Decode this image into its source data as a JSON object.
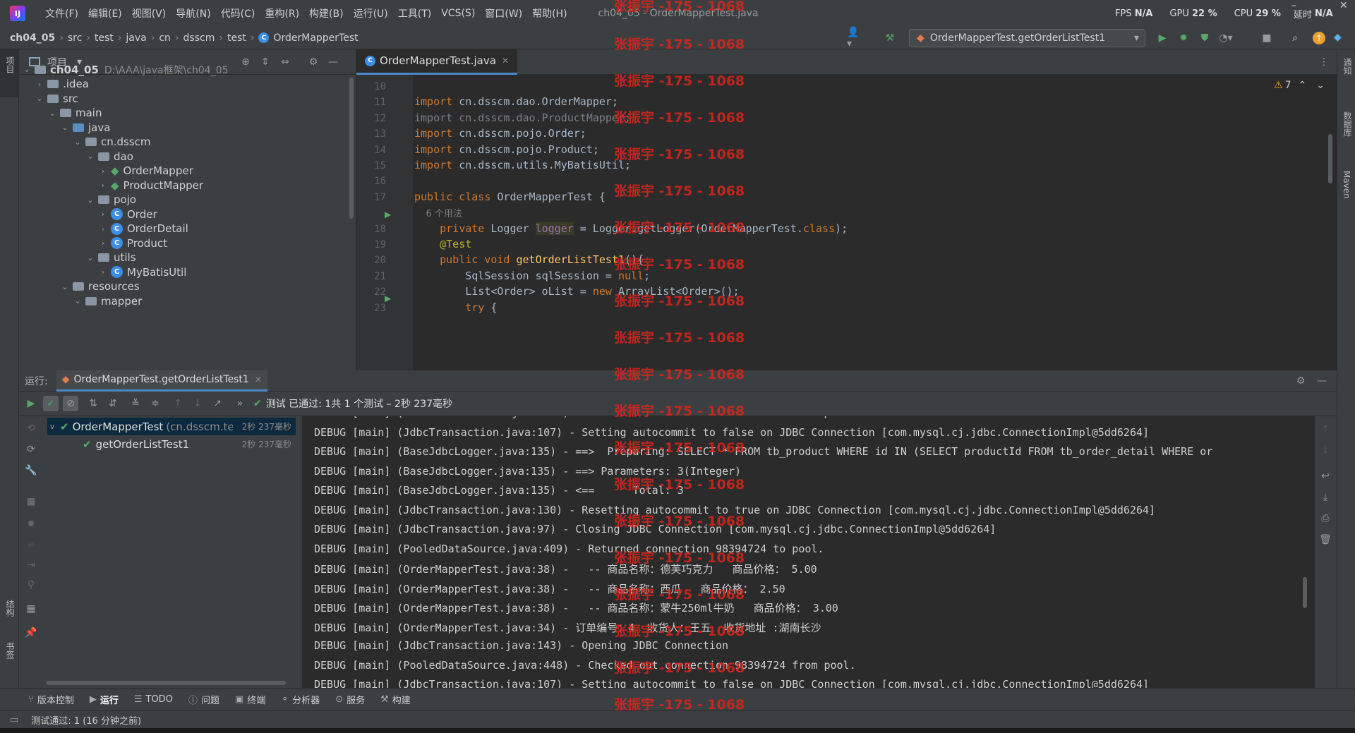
{
  "app": {
    "window_title": "ch04_05 - OrderMapperTest.java",
    "menus": [
      "文件(F)",
      "编辑(E)",
      "视图(V)",
      "导航(N)",
      "代码(C)",
      "重构(R)",
      "构建(B)",
      "运行(U)",
      "工具(T)",
      "VCS(S)",
      "窗口(W)",
      "帮助(H)"
    ],
    "stats": {
      "fps_label": "FPS",
      "fps": "N/A",
      "gpu_label": "GPU",
      "gpu": "22 %",
      "cpu_label": "CPU",
      "cpu": "29 %",
      "latency_label": "延时",
      "latency": "N/A"
    }
  },
  "breadcrumb": [
    "ch04_05",
    "src",
    "test",
    "java",
    "cn",
    "dsscm",
    "test",
    "OrderMapperTest"
  ],
  "run_config": "OrderMapperTest.getOrderListTest1",
  "project": {
    "title": "项目",
    "tree": [
      {
        "label": "ch04_05",
        "extra": "D:\\AAA\\java框架\\ch04_05",
        "depth": 0,
        "arrow": "v",
        "kind": "folder"
      },
      {
        "label": ".idea",
        "depth": 1,
        "arrow": ">",
        "kind": "folder"
      },
      {
        "label": "src",
        "depth": 1,
        "arrow": "v",
        "kind": "folder"
      },
      {
        "label": "main",
        "depth": 2,
        "arrow": "v",
        "kind": "folder"
      },
      {
        "label": "java",
        "depth": 3,
        "arrow": "v",
        "kind": "blue"
      },
      {
        "label": "cn.dsscm",
        "depth": 4,
        "arrow": "v",
        "kind": "folder"
      },
      {
        "label": "dao",
        "depth": 5,
        "arrow": "v",
        "kind": "folder"
      },
      {
        "label": "OrderMapper",
        "depth": 6,
        "arrow": ">",
        "kind": "mapper"
      },
      {
        "label": "ProductMapper",
        "depth": 6,
        "arrow": ">",
        "kind": "mapper"
      },
      {
        "label": "pojo",
        "depth": 5,
        "arrow": "v",
        "kind": "folder"
      },
      {
        "label": "Order",
        "depth": 6,
        "arrow": ">",
        "kind": "class"
      },
      {
        "label": "OrderDetail",
        "depth": 6,
        "arrow": ">",
        "kind": "class"
      },
      {
        "label": "Product",
        "depth": 6,
        "arrow": ">",
        "kind": "class"
      },
      {
        "label": "utils",
        "depth": 5,
        "arrow": "v",
        "kind": "folder"
      },
      {
        "label": "MyBatisUtil",
        "depth": 6,
        "arrow": ">",
        "kind": "class"
      },
      {
        "label": "resources",
        "depth": 3,
        "arrow": "v",
        "kind": "folder"
      },
      {
        "label": "mapper",
        "depth": 4,
        "arrow": "v",
        "kind": "folder"
      }
    ]
  },
  "editor": {
    "tab": "OrderMapperTest.java",
    "warnings": "7",
    "lines": [
      {
        "n": "10",
        "t": ""
      },
      {
        "n": "11",
        "t": "import cn.dsscm.dao.OrderMapper;"
      },
      {
        "n": "12",
        "t": "import cn.dsscm.dao.ProductMapper;"
      },
      {
        "n": "13",
        "t": "import cn.dsscm.pojo.Order;"
      },
      {
        "n": "14",
        "t": "import cn.dsscm.pojo.Product;"
      },
      {
        "n": "15",
        "t": "import cn.dsscm.utils.MyBatisUtil;"
      },
      {
        "n": "16",
        "t": ""
      },
      {
        "n": "17",
        "t": "public class OrderMapperTest {"
      },
      {
        "n": "",
        "t": "    6 个用法"
      },
      {
        "n": "18",
        "t": "    private Logger logger = Logger.getLogger(OrderMapperTest.class);"
      },
      {
        "n": "19",
        "t": "    @Test"
      },
      {
        "n": "20",
        "t": "    public void getOrderListTest1(){"
      },
      {
        "n": "21",
        "t": "        SqlSession sqlSession = null;"
      },
      {
        "n": "22",
        "t": "        List<Order> oList = new ArrayList<Order>();"
      },
      {
        "n": "23",
        "t": "        try {"
      }
    ]
  },
  "run": {
    "label": "运行:",
    "tab": "OrderMapperTest.getOrderListTest1",
    "status": "测试 已通过: 1共 1 个测试 – 2秒 237毫秒",
    "tests": [
      {
        "label": "OrderMapperTest",
        "pkg": "(cn.dsscm.te",
        "time": "2秒 237毫秒"
      },
      {
        "label": "getOrderListTest1",
        "time": "2秒 237毫秒"
      }
    ],
    "console": [
      "DEBUG [main] (PooledDataSource.java:448) - Checked out connection 98394724 from pool.",
      "DEBUG [main] (JdbcTransaction.java:107) - Setting autocommit to false on JDBC Connection [com.mysql.cj.jdbc.ConnectionImpl@5dd6264]",
      "DEBUG [main] (BaseJdbcLogger.java:135) - ==>  Preparing: SELECT * FROM tb_product WHERE id IN (SELECT productId FROM tb_order_detail WHERE or",
      "DEBUG [main] (BaseJdbcLogger.java:135) - ==> Parameters: 3(Integer)",
      "DEBUG [main] (BaseJdbcLogger.java:135) - <==      Total: 3",
      "DEBUG [main] (JdbcTransaction.java:130) - Resetting autocommit to true on JDBC Connection [com.mysql.cj.jdbc.ConnectionImpl@5dd6264]",
      "DEBUG [main] (JdbcTransaction.java:97) - Closing JDBC Connection [com.mysql.cj.jdbc.ConnectionImpl@5dd6264]",
      "DEBUG [main] (PooledDataSource.java:409) - Returned connection 98394724 to pool.",
      "DEBUG [main] (OrderMapperTest.java:38) -   -- 商品名称：德芙巧克力   商品价格： 5.00",
      "DEBUG [main] (OrderMapperTest.java:38) -   -- 商品名称：西瓜   商品价格： 2.50",
      "DEBUG [main] (OrderMapperTest.java:38) -   -- 商品名称：蒙牛250ml牛奶   商品价格： 3.00",
      "DEBUG [main] (OrderMapperTest.java:34) - 订单编号：4  收货人：王五  收货地址 :湖南长沙",
      "DEBUG [main] (JdbcTransaction.java:143) - Opening JDBC Connection",
      "DEBUG [main] (PooledDataSource.java:448) - Checked out connection 98394724 from pool.",
      "DEBUG [main] (JdbcTransaction.java:107) - Setting autocommit to false on JDBC Connection [com.mysql.cj.jdbc.ConnectionImpl@5dd6264]"
    ]
  },
  "bottom_tabs": [
    "版本控制",
    "运行",
    "TODO",
    "问题",
    "终端",
    "分析器",
    "服务",
    "构建"
  ],
  "status_text": "测试通过: 1 (16 分钟之前)",
  "watermark": "张振宇 -175 - 1068",
  "right_sidebar": [
    "通知",
    "数据库",
    "Maven"
  ],
  "left_sidebar": [
    "项目",
    "结构",
    "书签"
  ]
}
